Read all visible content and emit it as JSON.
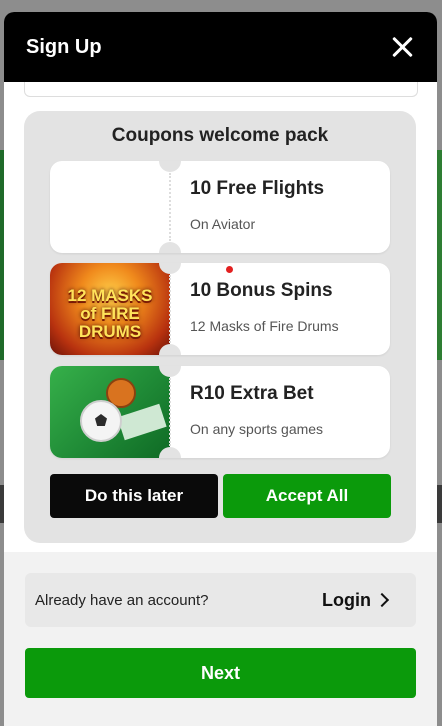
{
  "modal": {
    "title": "Sign Up"
  },
  "coupons": {
    "title": "Coupons welcome pack",
    "items": [
      {
        "title": "10 Free Flights",
        "subtitle": "On Aviator",
        "thumb": "blank"
      },
      {
        "title": "10 Bonus Spins",
        "subtitle": "12 Masks of Fire Drums",
        "thumb": "fire-drums-art",
        "thumb_text": "12 MASKS of FIRE DRUMS"
      },
      {
        "title": "R10 Extra Bet",
        "subtitle": "On any sports games",
        "thumb": "sports-balls-art"
      }
    ],
    "later_label": "Do this later",
    "accept_label": "Accept All"
  },
  "account": {
    "prompt": "Already have an account?",
    "login_label": "Login"
  },
  "next_label": "Next",
  "colors": {
    "header_bg": "#000000",
    "accent_green": "#0b9a0b",
    "panel_bg": "#e3e3e3"
  }
}
